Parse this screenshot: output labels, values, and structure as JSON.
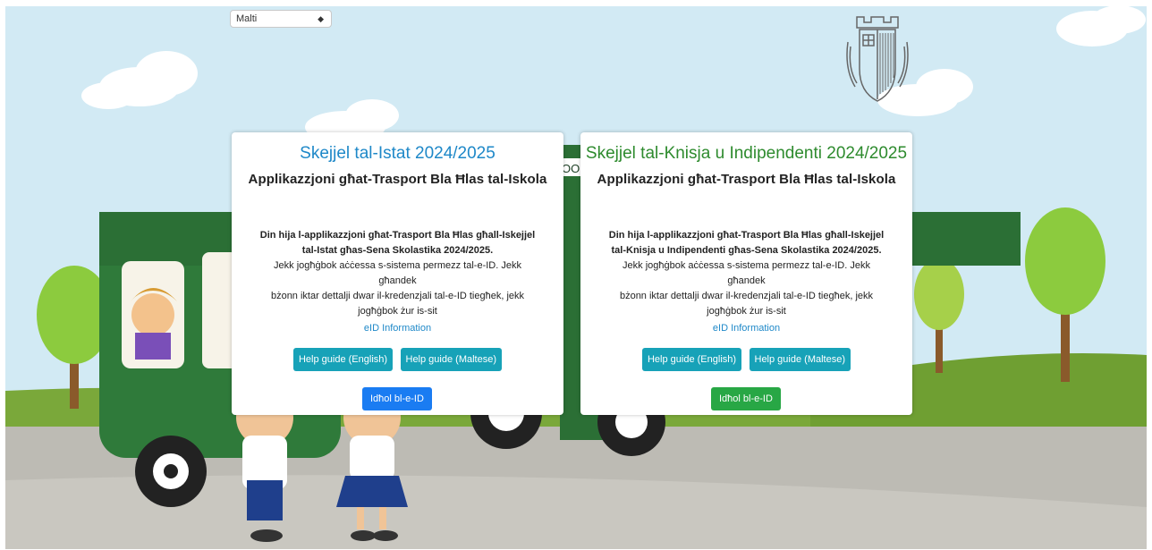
{
  "language_select": {
    "value": "Malti"
  },
  "cards": [
    {
      "title": "Skejjel tal-Istat 2024/2025",
      "subtitle": "Applikazzjoni għat-Trasport Bla Ħlas tal-Iskola",
      "desc_bold_1": "Din hija l-applikazzjoni għat-Trasport Bla Ħlas għall-Iskejjel",
      "desc_bold_2": "tal-Istat għas-Sena Skolastika 2024/2025.",
      "desc_1": "Jekk jogħġbok aċċessa s-sistema permezz tal-e-ID. Jekk għandek",
      "desc_2": "bżonn iktar dettalji dwar il-kredenzjali tal-e-ID tiegħek, jekk",
      "desc_3": "jogħġbok żur is-sit",
      "eid_link": "eID Information",
      "help_en": "Help guide (English)",
      "help_mt": "Help guide (Maltese)",
      "login": "Idħol bl-e-ID"
    },
    {
      "title": "Skejjel tal-Knisja u Indipendenti 2024/2025",
      "subtitle": "Applikazzjoni għat-Trasport Bla Ħlas tal-Iskola",
      "desc_bold_1": "Din hija l-applikazzjoni għat-Trasport Bla Ħlas għall-Iskejjel",
      "desc_bold_2": "tal-Knisja u Indipendenti għas-Sena Skolastika 2024/2025.",
      "desc_1": "Jekk jogħġbok aċċessa s-sistema permezz tal-e-ID. Jekk għandek",
      "desc_2": "bżonn iktar dettalji dwar il-kredenzjali tal-e-ID tiegħek, jekk",
      "desc_3": "jogħġbok żur is-sit",
      "eid_link": "eID Information",
      "help_en": "Help guide (English)",
      "help_mt": "Help guide (Maltese)",
      "login": "Idħol bl-e-ID"
    }
  ],
  "bus_sign_fragment": "OOL",
  "colors": {
    "state_accent": "#1e88c8",
    "church_accent": "#2e8b2e",
    "help_button": "#17a2b8",
    "login_state": "#1a7cf2",
    "login_church": "#28a745"
  }
}
